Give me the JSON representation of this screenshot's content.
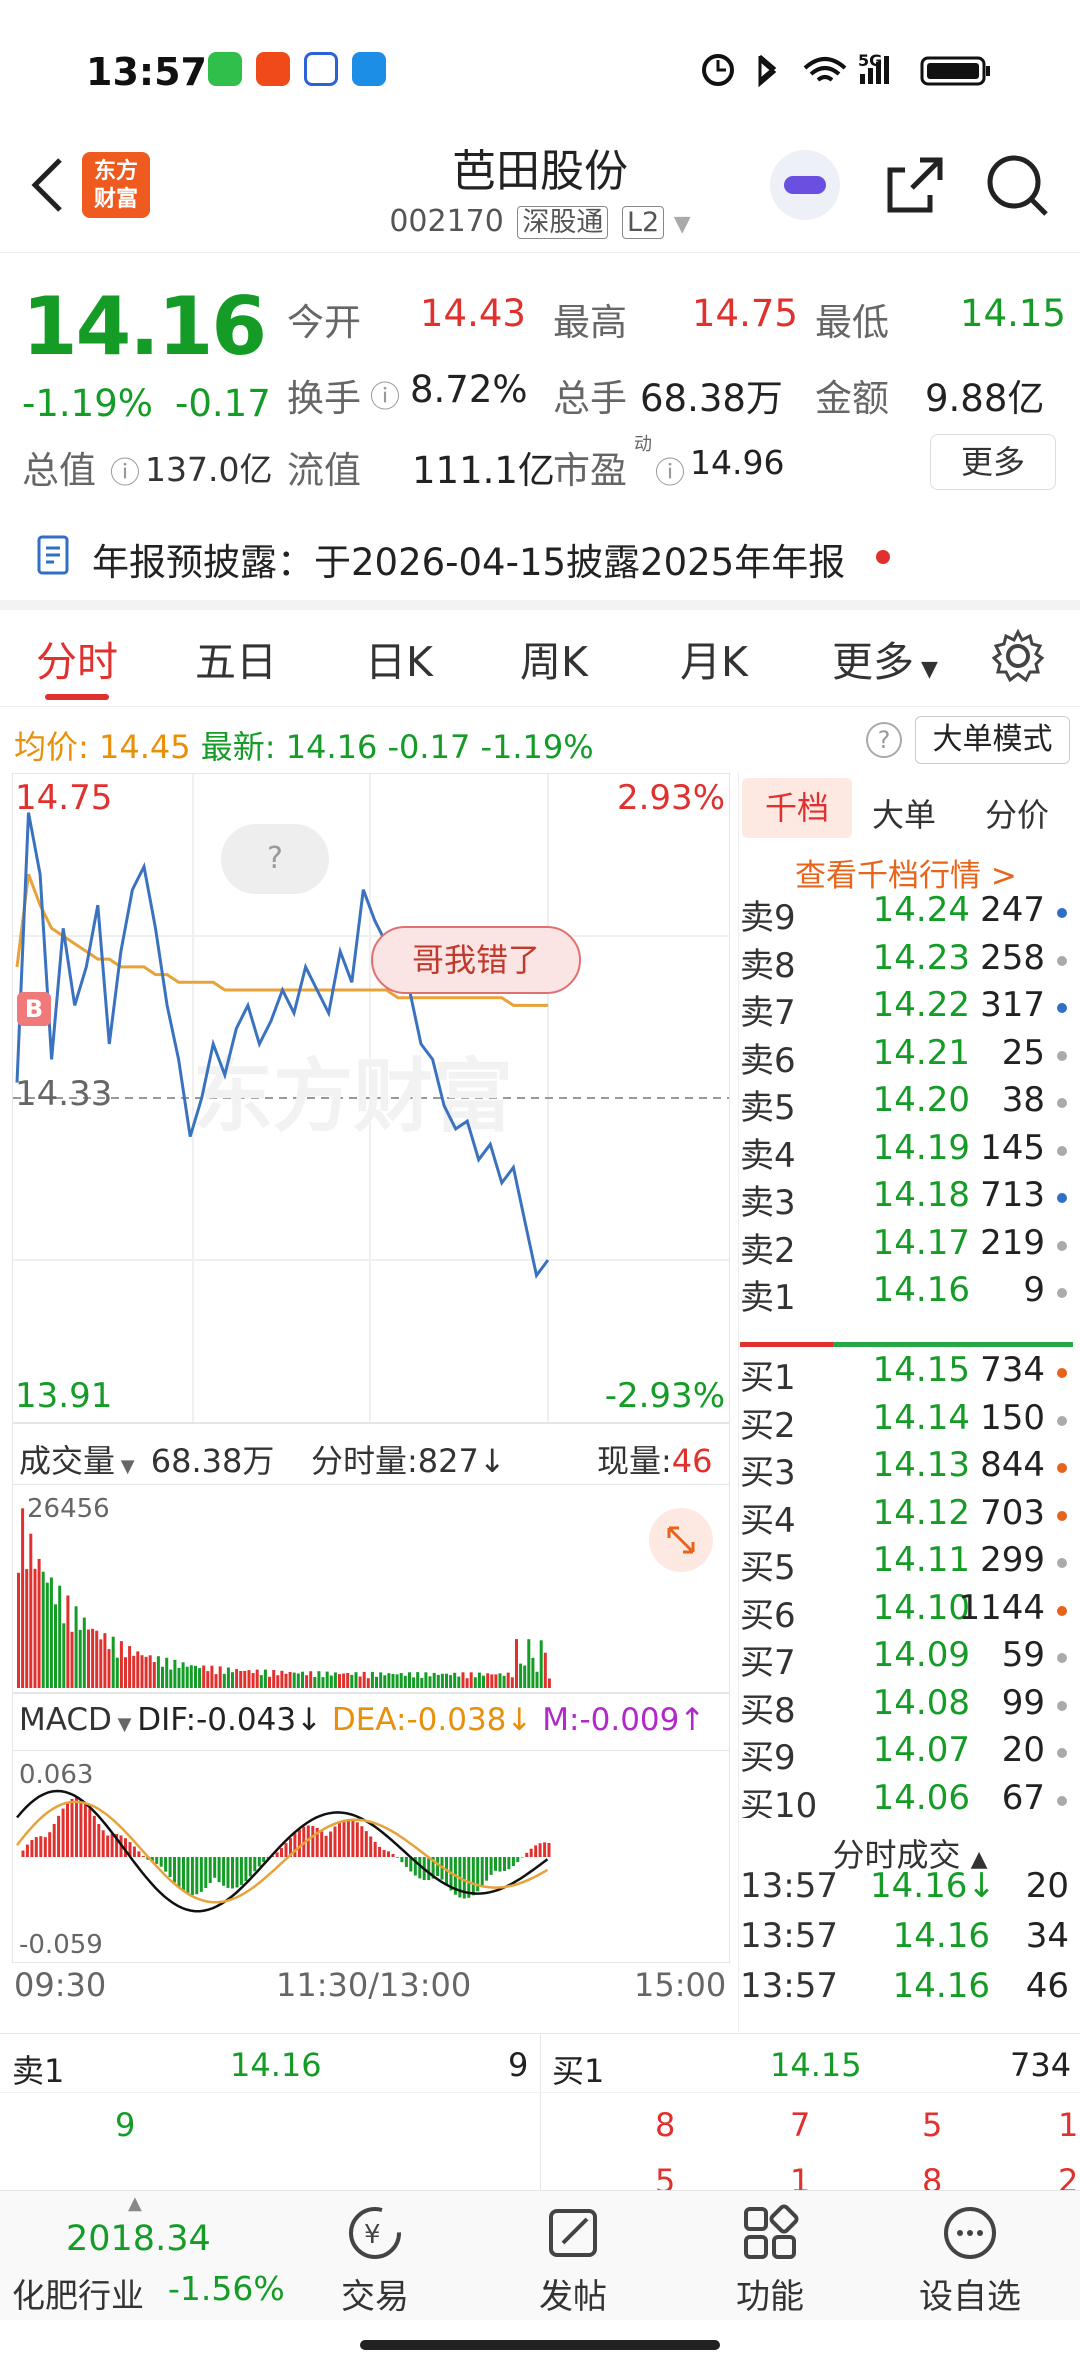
{
  "status_bar": {
    "time": "13:57"
  },
  "header": {
    "logo_line1": "东方",
    "logo_line2": "财富",
    "title": "芭田股份",
    "code": "002170",
    "tag1": "深股通",
    "tag2": "L2"
  },
  "quote": {
    "price": "14.16",
    "change_pct": "-1.19%",
    "change": "-0.17",
    "open_label": "今开",
    "open": "14.43",
    "high_label": "最高",
    "high": "14.75",
    "low_label": "最低",
    "low": "14.15",
    "turnover_label": "换手",
    "turnover": "8.72%",
    "volume_label": "总手",
    "volume": "68.38万",
    "amount_label": "金额",
    "amount": "9.88亿",
    "mktcap_label": "总值",
    "mktcap": "137.0亿",
    "float_label": "流值",
    "float": "111.1亿",
    "pe_label": "市盈",
    "pe_sup": "动",
    "pe": "14.96",
    "more_btn": "更多"
  },
  "notice": {
    "text": "年报预披露：于2026-04-15披露2025年年报"
  },
  "tabs": [
    "分时",
    "五日",
    "日K",
    "周K",
    "月K",
    "更多"
  ],
  "chart_info": {
    "avg_label": "均价:",
    "avg": "14.45",
    "latest_label": "最新:",
    "latest": "14.16",
    "latest_change": "-0.17",
    "latest_pct": "-1.19%",
    "mode_btn": "大单模式"
  },
  "chart_data": {
    "type": "line",
    "title": "",
    "x_ticks": [
      "09:30",
      "11:30/13:00",
      "15:00"
    ],
    "ylim": [
      13.91,
      14.75
    ],
    "y_labels_left": [
      "14.75",
      "14.33",
      "13.91"
    ],
    "y_labels_right": [
      "2.93%",
      "-2.93%"
    ],
    "prev_close": 14.33,
    "series": [
      {
        "values": [
          14.35,
          14.7,
          14.62,
          14.38,
          14.55,
          14.45,
          14.5,
          14.58,
          14.4,
          14.52,
          14.6,
          14.63,
          14.55,
          14.45,
          14.38,
          14.28,
          14.33,
          14.4,
          14.36,
          14.42,
          14.45,
          14.4,
          14.43,
          14.47,
          14.44,
          14.5,
          14.47,
          14.44,
          14.52,
          14.48,
          14.6,
          14.56,
          14.53,
          14.5,
          14.47,
          14.4,
          14.38,
          14.32,
          14.29,
          14.3,
          14.25,
          14.27,
          14.22,
          14.24,
          14.17,
          14.1,
          14.12
        ]
      },
      {
        "values": [
          14.5,
          14.62,
          14.58,
          14.55,
          14.54,
          14.53,
          14.52,
          14.51,
          14.51,
          14.5,
          14.5,
          14.5,
          14.49,
          14.49,
          14.48,
          14.48,
          14.48,
          14.48,
          14.47,
          14.47,
          14.47,
          14.47,
          14.47,
          14.47,
          14.47,
          14.47,
          14.47,
          14.47,
          14.47,
          14.47,
          14.47,
          14.47,
          14.47,
          14.46,
          14.46,
          14.46,
          14.46,
          14.46,
          14.46,
          14.46,
          14.46,
          14.46,
          14.46,
          14.45,
          14.45,
          14.45,
          14.45
        ]
      }
    ]
  },
  "annotations": {
    "bubble": "哥我错了",
    "b_marker": "B",
    "question": "?"
  },
  "volume_panel": {
    "label": "成交量",
    "total": "68.38万",
    "minute_label": "分时量:",
    "minute": "827",
    "now_label": "现量:",
    "now": "46",
    "max": "26456"
  },
  "macd_panel": {
    "label": "MACD",
    "dif": "DIF:-0.043",
    "dea": "DEA:-0.038",
    "m": "M:-0.009",
    "top": "0.063",
    "bottom": "-0.059"
  },
  "orderbook": {
    "tabs": [
      "千档",
      "大单",
      "分价"
    ],
    "link": "查看千档行情 >",
    "asks": [
      {
        "label": "卖9",
        "price": "14.24",
        "vol": "247",
        "dot": "#2f6fc4"
      },
      {
        "label": "卖8",
        "price": "14.23",
        "vol": "258",
        "dot": "#aaaaaa"
      },
      {
        "label": "卖7",
        "price": "14.22",
        "vol": "317",
        "dot": "#2f6fc4"
      },
      {
        "label": "卖6",
        "price": "14.21",
        "vol": "25",
        "dot": "#aaaaaa"
      },
      {
        "label": "卖5",
        "price": "14.20",
        "vol": "38",
        "dot": "#aaaaaa"
      },
      {
        "label": "卖4",
        "price": "14.19",
        "vol": "145",
        "dot": "#aaaaaa"
      },
      {
        "label": "卖3",
        "price": "14.18",
        "vol": "713",
        "dot": "#2f6fc4"
      },
      {
        "label": "卖2",
        "price": "14.17",
        "vol": "219",
        "dot": "#aaaaaa"
      },
      {
        "label": "卖1",
        "price": "14.16",
        "vol": "9",
        "dot": "#aaaaaa"
      }
    ],
    "bids": [
      {
        "label": "买1",
        "price": "14.15",
        "vol": "734",
        "dot": "#e8641a"
      },
      {
        "label": "买2",
        "price": "14.14",
        "vol": "150",
        "dot": "#aaaaaa"
      },
      {
        "label": "买3",
        "price": "14.13",
        "vol": "844",
        "dot": "#e8641a"
      },
      {
        "label": "买4",
        "price": "14.12",
        "vol": "703",
        "dot": "#e8641a"
      },
      {
        "label": "买5",
        "price": "14.11",
        "vol": "299",
        "dot": "#aaaaaa"
      },
      {
        "label": "买6",
        "price": "14.10",
        "vol": "1144",
        "dot": "#e8641a"
      },
      {
        "label": "买7",
        "price": "14.09",
        "vol": "59",
        "dot": "#aaaaaa"
      },
      {
        "label": "买8",
        "price": "14.08",
        "vol": "99",
        "dot": "#aaaaaa"
      },
      {
        "label": "买9",
        "price": "14.07",
        "vol": "20",
        "dot": "#aaaaaa"
      },
      {
        "label": "买10",
        "price": "14.06",
        "vol": "67",
        "dot": "#aaaaaa"
      }
    ],
    "ticks_title": "分时成交",
    "ticks": [
      {
        "time": "13:57",
        "price": "14.16↓",
        "vol": "20"
      },
      {
        "time": "13:57",
        "price": "14.16",
        "vol": "34"
      },
      {
        "time": "13:57",
        "price": "14.16",
        "vol": "46"
      }
    ]
  },
  "bottom_bar": {
    "sell_label": "卖1",
    "sell_price": "14.16",
    "sell_vol": "9",
    "buy_label": "买1",
    "buy_price": "14.15",
    "buy_vol": "734",
    "sell_queue": [
      "9"
    ],
    "buy_queue": [
      "8",
      "7",
      "5",
      "1"
    ],
    "buy_queue2": [
      "5",
      "1",
      "8",
      "2"
    ]
  },
  "nav": {
    "index_value": "2018.34",
    "industry": "化肥行业",
    "industry_pct": "-1.56%",
    "items": [
      "交易",
      "发帖",
      "功能",
      "设自选"
    ]
  }
}
